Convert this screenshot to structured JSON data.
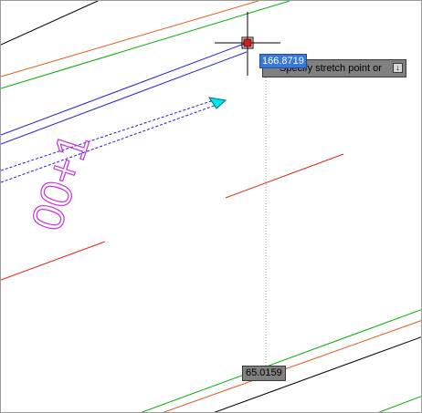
{
  "command_prompt": {
    "text": "Specify stretch point or",
    "options_arrow": "↓"
  },
  "dynamic_input": {
    "value": "166.8719"
  },
  "dimension_tooltip": {
    "value": "65.0159"
  },
  "annotation_text": {
    "text": "00+1"
  },
  "colors": {
    "green": "#00aa00",
    "orange": "#e05a1e",
    "red": "#e61e1e",
    "blue": "#1e1ed6",
    "magenta": "#c832dc",
    "cyan": "#00e6f0",
    "black": "#000000",
    "highlight": "#3a78d6"
  },
  "icons": {
    "crosshair": "crosshair-cursor-icon",
    "grip": "grip-square-icon",
    "arrow_grip": "cyan-triangle-grip-icon",
    "options": "down-arrow-icon"
  }
}
